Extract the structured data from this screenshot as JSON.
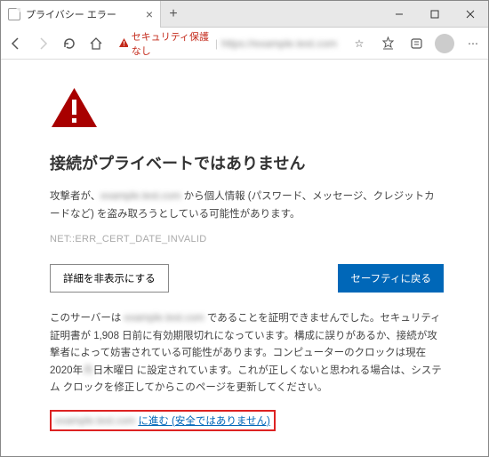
{
  "titlebar": {
    "tab_title": "プライバシー エラー",
    "close_glyph": "×",
    "newtab_glyph": "+"
  },
  "toolbar": {
    "security_text": "セキュリティ保護なし",
    "url_blur": "https://example.test.com",
    "divider": "|",
    "star": "☆",
    "dots": "⋯"
  },
  "page": {
    "heading": "接続がプライベートではありません",
    "para1_prefix": "攻撃者が、",
    "para1_blur": "example.test.com",
    "para1_suffix": " から個人情報 (パスワード、メッセージ、クレジットカードなど) を盗み取ろうとしている可能性があります。",
    "error_code": "NET::ERR_CERT_DATE_INVALID",
    "hide_details_label": "詳細を非表示にする",
    "back_safety_label": "セーフティに戻る",
    "details_prefix": "このサーバーは ",
    "details_blur1": "example.test.com",
    "details_mid1": " であることを証明できませんでした。セキュリティ証明書が 1,908 日前に有効期限切れになっています。構成に誤りがあるか、接続が攻撃者によって妨害されている可能性があります。コンピューターのクロックは現在 2020年",
    "details_blur2": "月",
    "details_mid2": "日木曜日 に設定されています。これが正しくないと思われる場合は、システム クロックを修正してからこのページを更新してください。",
    "proceed_blur": "example.test.com",
    "proceed_text": "に進む (安全ではありません)"
  }
}
